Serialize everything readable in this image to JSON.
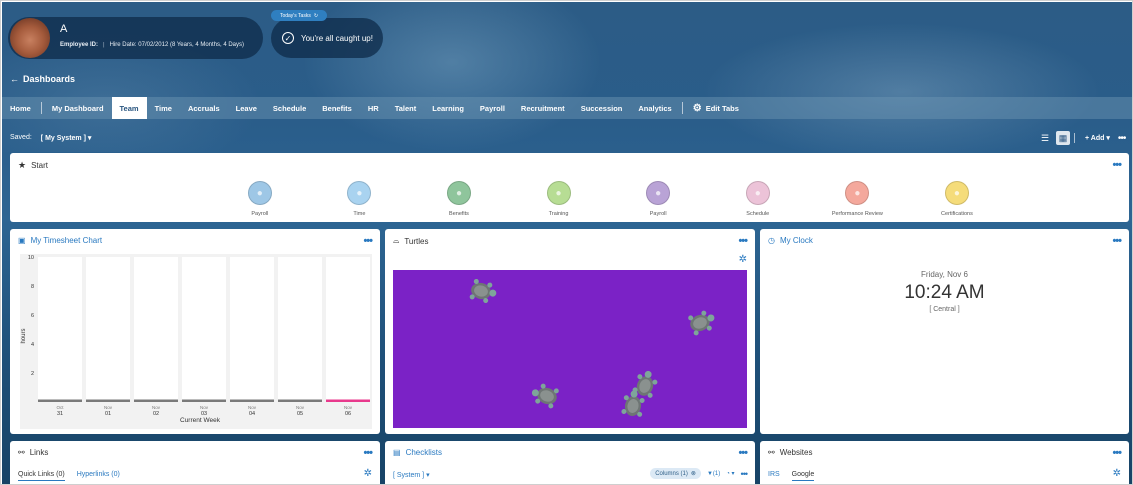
{
  "employee": {
    "name": "A",
    "id_label": "Employee ID:",
    "id_value": "",
    "hire_label": "Hire Date:",
    "hire_value": "07/02/2012 (8 Years, 4 Months, 4 Days)"
  },
  "tasks": {
    "tag": "Today's Tasks",
    "status": "You're all caught up!"
  },
  "header": {
    "back_label": "Dashboards"
  },
  "tabs": [
    {
      "label": "Home"
    },
    {
      "label": "My Dashboard"
    },
    {
      "label": "Team"
    },
    {
      "label": "Time"
    },
    {
      "label": "Accruals"
    },
    {
      "label": "Leave"
    },
    {
      "label": "Schedule"
    },
    {
      "label": "Benefits"
    },
    {
      "label": "HR"
    },
    {
      "label": "Talent"
    },
    {
      "label": "Learning"
    },
    {
      "label": "Payroll"
    },
    {
      "label": "Recruitment"
    },
    {
      "label": "Succession"
    },
    {
      "label": "Analytics"
    }
  ],
  "active_tab": "Team",
  "edit_tabs_label": "Edit Tabs",
  "saved": {
    "label": "Saved:",
    "value": "[ My System ]"
  },
  "toolbar": {
    "add_label": "+ Add"
  },
  "start": {
    "title": "Start",
    "items": [
      {
        "label": "Payroll",
        "color": "#9ec7e6",
        "icon": "money-icon"
      },
      {
        "label": "Time",
        "color": "#a9d3f0",
        "icon": "stopwatch-icon"
      },
      {
        "label": "Benefits",
        "color": "#8fc59c",
        "icon": "people-icon"
      },
      {
        "label": "Training",
        "color": "#b7dd94",
        "icon": "hat-icon"
      },
      {
        "label": "Payroll",
        "color": "#b9a3d6",
        "icon": "money-icon"
      },
      {
        "label": "Schedule",
        "color": "#ecc3d8",
        "icon": "calendar-icon"
      },
      {
        "label": "Performance Review",
        "color": "#f4a89c",
        "icon": "review-icon"
      },
      {
        "label": "Certifications",
        "color": "#f5dc7a",
        "icon": "medal-icon"
      }
    ]
  },
  "timesheet": {
    "title": "My Timesheet Chart",
    "chart_data": {
      "type": "bar",
      "xlabel": "Current Week",
      "ylabel": "hours",
      "ylim": [
        0,
        10
      ],
      "yticks": [
        "2",
        "4",
        "6",
        "8",
        "10"
      ],
      "categories": [
        {
          "month": "Oct",
          "day": "31"
        },
        {
          "month": "Nov",
          "day": "01"
        },
        {
          "month": "Nov",
          "day": "02"
        },
        {
          "month": "Nov",
          "day": "03"
        },
        {
          "month": "Nov",
          "day": "04"
        },
        {
          "month": "Nov",
          "day": "05"
        },
        {
          "month": "Nov",
          "day": "06"
        }
      ],
      "values": [
        0,
        0,
        0,
        0,
        0,
        0,
        0
      ],
      "highlight_color": "#e8398c"
    }
  },
  "turtles": {
    "title": "Turtles",
    "bg_color": "#7b22c6"
  },
  "clock": {
    "title": "My Clock",
    "day": "Friday, Nov 6",
    "time": "10:24 AM",
    "zone": "[ Central ]"
  },
  "links": {
    "title": "Links",
    "quick": "Quick Links (0)",
    "hyper": "Hyperlinks (0)"
  },
  "checklists": {
    "title": "Checklists",
    "filter": "[ System ]",
    "columns": "Columns (1)",
    "filter_count": "(1)"
  },
  "websites": {
    "title": "Websites",
    "items": [
      "IRS",
      "Google"
    ]
  }
}
